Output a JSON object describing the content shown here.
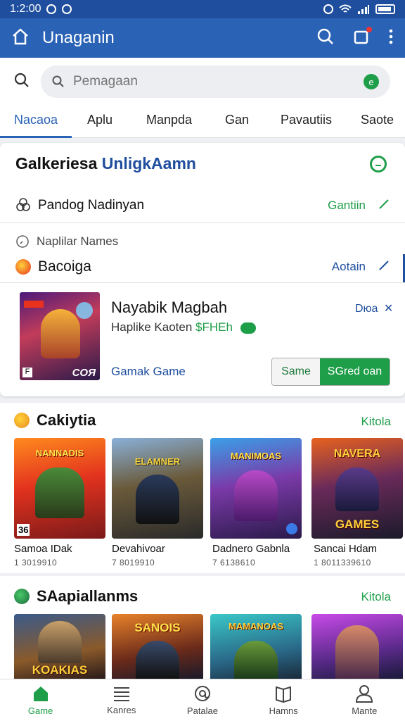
{
  "status": {
    "time": "1:2:00"
  },
  "app_bar": {
    "title": "Unaganin"
  },
  "search": {
    "placeholder": "Pemagaan"
  },
  "tabs": [
    "Nacaoa",
    "Aplu",
    "Manpda",
    "Gan",
    "Pavautiis",
    "Saote"
  ],
  "card": {
    "title_black": "Galkeriesa",
    "title_blue": "UnligkAamn",
    "row1": {
      "label": "Pandog Nadinyan",
      "link": "Gantiin"
    },
    "row2": {
      "label": "Naplilar Names"
    },
    "row3": {
      "label": "Bacoiga",
      "link": "Aotain"
    },
    "featured": {
      "title": "Nayabik Magbah",
      "subtitle": "Haplike Kaoten",
      "price": "$FHEh",
      "category": "Gamak Game",
      "tag": "Dюa",
      "btn_left": "Same",
      "btn_right": "SGred oan",
      "art_text": "COЯ"
    }
  },
  "section1": {
    "title": "Cakiytia",
    "more": "Kitola",
    "tiles": [
      {
        "name": "Samoa IDak",
        "num": "1 3019910",
        "art": "NANNADIS",
        "art_bottom": "36"
      },
      {
        "name": "Devahivoar",
        "num": "7 8019910",
        "art": "ELAMNER",
        "art_bottom": ""
      },
      {
        "name": "Dadnero Gabnla",
        "num": "7 6138610",
        "art": "MANIMOAS",
        "art_bottom": ""
      },
      {
        "name": "Sancai Hdam",
        "num": "1 8011339610",
        "art": "NAVERA",
        "art_bottom": "GAMES"
      }
    ]
  },
  "section2": {
    "title": "SAapiallanms",
    "more": "Kitola",
    "tiles": [
      {
        "art": "KOAKIAS"
      },
      {
        "art": "SANOIS"
      },
      {
        "art": "MAMANOAS"
      },
      {
        "art": ""
      }
    ]
  },
  "bottom_nav": [
    "Game",
    "Kanres",
    "Patalae",
    "Hamns",
    "Mante"
  ],
  "colors": {
    "primary": "#2a62b6",
    "accent": "#1e9e49",
    "dark_blue": "#1f4e9e"
  }
}
